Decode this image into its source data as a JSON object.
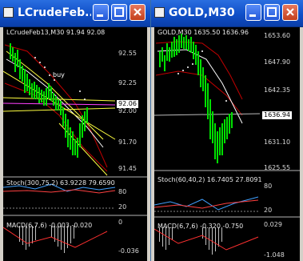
{
  "windows": [
    {
      "title": "LCrudeFeb...",
      "header": "LCrudeFeb13,M30  91.94 92.08",
      "price_scale": [
        "92.55",
        "92.25",
        "92.00",
        "91.70",
        "91.45"
      ],
      "current_price": "92.06",
      "signal_label": "buy",
      "stoch_label": "Stoch(300,75,2) 63.9228 79.6590",
      "stoch_scale": [
        "80",
        "20"
      ],
      "macd_label": "MACD(6,7,6) -0.003 -0.020",
      "macd_scale": [
        "0",
        "-0.036"
      ]
    },
    {
      "title": "GOLD,M30",
      "header": "GOLD,M30  1635.50 1636.96",
      "price_scale": [
        "1653.60",
        "1647.90",
        "1642.35",
        "1631.10",
        "1625.55"
      ],
      "current_price": "1636.94",
      "stoch_label": "Stoch(60,40,2) 16.7405 27.8091",
      "stoch_scale": [
        "80",
        "20"
      ],
      "macd_label": "MACD(6,7,6) -0.320 -0.750",
      "macd_scale": [
        "0.029",
        "-1.048"
      ]
    }
  ],
  "colors": {
    "title_bar": "#0f4fc8",
    "candles": "#00e000",
    "close_button": "#c33f1c",
    "chart_bg": "#000000"
  }
}
